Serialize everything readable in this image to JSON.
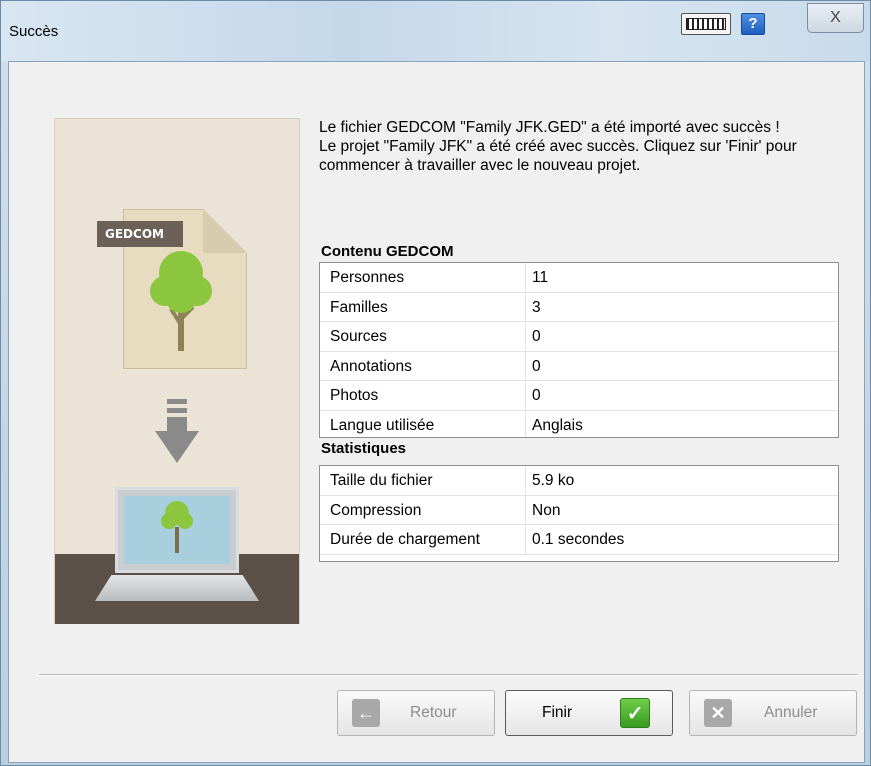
{
  "window": {
    "title": "Succès",
    "close_symbol": "X",
    "help_symbol": "?"
  },
  "message": {
    "line1": "Le fichier GEDCOM \"Family JFK.GED\" a été importé avec succès !",
    "line2": "Le projet \"Family JFK\" a été créé avec succès. Cliquez sur 'Finir' pour commencer à travailler avec le nouveau projet."
  },
  "illustration": {
    "tag": "GEDCOM"
  },
  "contenu": {
    "title": "Contenu GEDCOM",
    "rows": [
      {
        "label": "Personnes",
        "value": "11"
      },
      {
        "label": "Familles",
        "value": "3"
      },
      {
        "label": "Sources",
        "value": "0"
      },
      {
        "label": "Annotations",
        "value": "0"
      },
      {
        "label": "Photos",
        "value": "0"
      },
      {
        "label": "Langue utilisée",
        "value": "Anglais"
      }
    ]
  },
  "statistiques": {
    "title": "Statistiques",
    "rows": [
      {
        "label": "Taille du fichier",
        "value": "5.9 ko"
      },
      {
        "label": "Compression",
        "value": "Non"
      },
      {
        "label": "Durée de chargement",
        "value": "0.1 secondes"
      }
    ]
  },
  "buttons": {
    "back": "Retour",
    "finish": "Finir",
    "cancel": "Annuler"
  },
  "icons": {
    "back": "arrow-left-icon",
    "finish": "checkmark-icon",
    "cancel": "x-icon"
  }
}
